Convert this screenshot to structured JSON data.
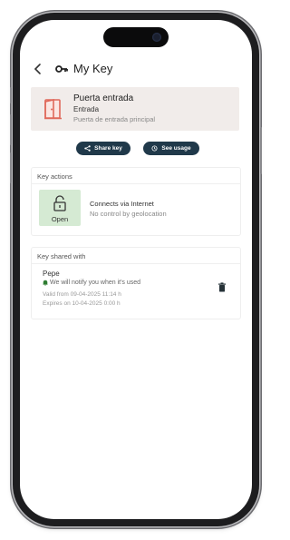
{
  "header": {
    "title": "My Key"
  },
  "lock": {
    "name": "Puerta entrada",
    "type": "Entrada",
    "description": "Puerta de entrada principal"
  },
  "actions": {
    "share_label": "Share key",
    "usage_label": "See usage"
  },
  "key_actions": {
    "title": "Key actions",
    "open_label": "Open",
    "connection": "Connects via Internet",
    "geolocation": "No control by geolocation"
  },
  "shared": {
    "title": "Key shared with",
    "user": "Pepe",
    "notify": "We will notify you when it's used",
    "valid_from": "Valid from 09-04-2025 11:14 h",
    "expires": "Expires on 10-04-2025 0:00 h"
  },
  "colors": {
    "accent": "#20394a",
    "door": "#e0685a",
    "open_bg": "#d5ead3",
    "notify_icon": "#2e7d32"
  }
}
